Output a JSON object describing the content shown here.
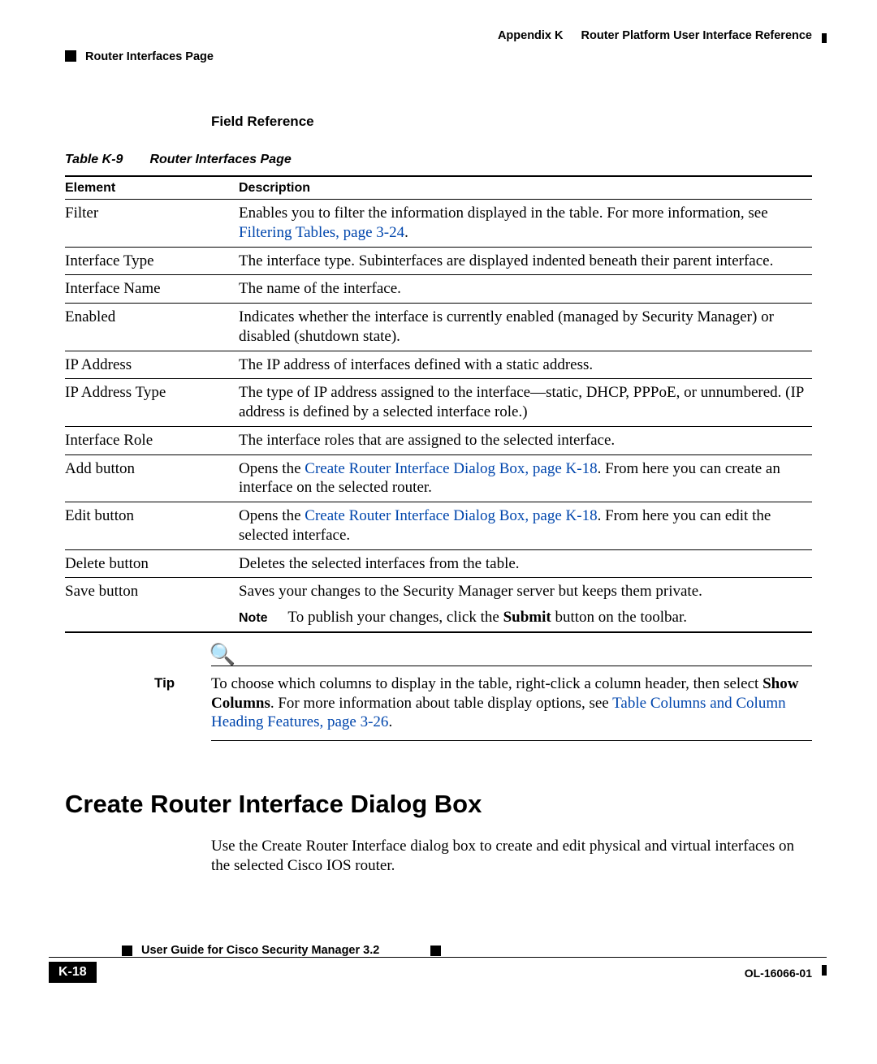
{
  "header": {
    "appendix": "Appendix K",
    "title": "Router Platform User Interface Reference",
    "section": "Router Interfaces Page"
  },
  "field_reference_heading": "Field Reference",
  "table_caption_num": "Table K-9",
  "table_caption_title": "Router Interfaces Page",
  "table": {
    "col_element": "Element",
    "col_description": "Description",
    "rows": {
      "filter": {
        "element": "Filter",
        "desc_a": "Enables you to filter the information displayed in the table. For more information, see ",
        "link": "Filtering Tables, page 3-24",
        "desc_b": "."
      },
      "iftype": {
        "element": "Interface Type",
        "desc": "The interface type. Subinterfaces are displayed indented beneath their parent interface."
      },
      "ifname": {
        "element": "Interface Name",
        "desc": "The name of the interface."
      },
      "enabled": {
        "element": "Enabled",
        "desc": "Indicates whether the interface is currently enabled (managed by Security Manager) or disabled (shutdown state)."
      },
      "ipaddr": {
        "element": "IP Address",
        "desc": "The IP address of interfaces defined with a static address."
      },
      "ipaddrtype": {
        "element": "IP Address Type",
        "desc": "The type of IP address assigned to the interface—static, DHCP, PPPoE, or unnumbered. (IP address is defined by a selected interface role.)"
      },
      "ifrole": {
        "element": "Interface Role",
        "desc": "The interface roles that are assigned to the selected interface."
      },
      "addbtn": {
        "element": "Add button",
        "desc_a": "Opens the ",
        "link": "Create Router Interface Dialog Box, page K-18",
        "desc_b": ". From here you can create an interface on the selected router."
      },
      "editbtn": {
        "element": "Edit button",
        "desc_a": "Opens the ",
        "link": "Create Router Interface Dialog Box, page K-18",
        "desc_b": ". From here you can edit the selected interface."
      },
      "delbtn": {
        "element": "Delete button",
        "desc": "Deletes the selected interfaces from the table."
      },
      "savebtn": {
        "element": "Save button",
        "desc": "Saves your changes to the Security Manager server but keeps them private.",
        "note_label": "Note",
        "note_a": "To publish your changes, click the ",
        "note_bold": "Submit",
        "note_b": " button on the toolbar."
      }
    }
  },
  "tip": {
    "label": "Tip",
    "text_a": "To choose which columns to display in the table, right-click a column header, then select ",
    "bold": "Show Columns",
    "text_b": ". For more information about table display options, see ",
    "link": "Table Columns and Column Heading Features, page 3-26",
    "text_c": "."
  },
  "h2": "Create Router Interface Dialog Box",
  "body_para": "Use the Create Router Interface dialog box to create and edit physical and virtual interfaces on the selected Cisco IOS router.",
  "footer": {
    "guide": "User Guide for Cisco Security Manager 3.2",
    "page": "K-18",
    "docid": "OL-16066-01"
  }
}
